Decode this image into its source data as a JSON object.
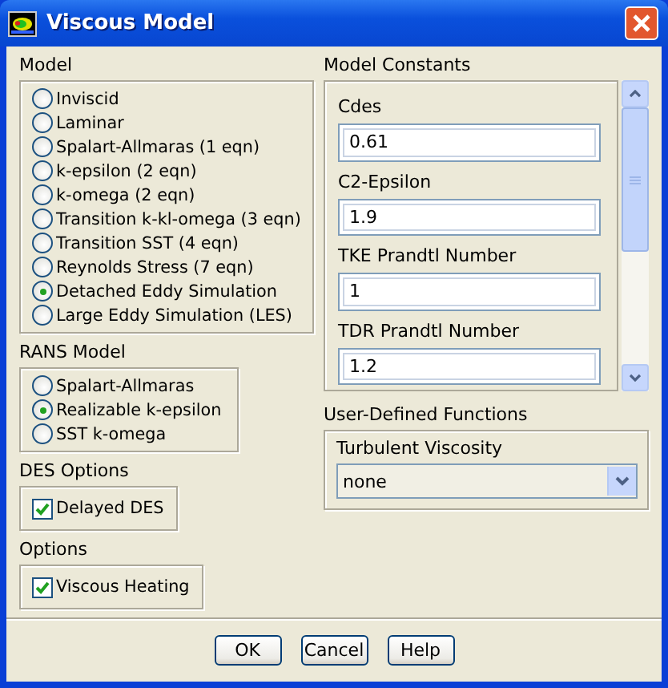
{
  "window": {
    "title": "Viscous Model"
  },
  "model": {
    "label": "Model",
    "options": [
      {
        "label": "Inviscid",
        "selected": false
      },
      {
        "label": "Laminar",
        "selected": false
      },
      {
        "label": "Spalart-Allmaras (1 eqn)",
        "selected": false
      },
      {
        "label": "k-epsilon (2 eqn)",
        "selected": false
      },
      {
        "label": "k-omega (2 eqn)",
        "selected": false
      },
      {
        "label": "Transition k-kl-omega (3 eqn)",
        "selected": false
      },
      {
        "label": "Transition SST (4 eqn)",
        "selected": false
      },
      {
        "label": "Reynolds Stress (7 eqn)",
        "selected": false
      },
      {
        "label": "Detached Eddy Simulation",
        "selected": true
      },
      {
        "label": "Large Eddy Simulation (LES)",
        "selected": false
      }
    ]
  },
  "rans_model": {
    "label": "RANS Model",
    "options": [
      {
        "label": "Spalart-Allmaras",
        "selected": false
      },
      {
        "label": "Realizable k-epsilon",
        "selected": true
      },
      {
        "label": "SST k-omega",
        "selected": false
      }
    ]
  },
  "des_options": {
    "label": "DES Options",
    "items": [
      {
        "label": "Delayed DES",
        "checked": true
      }
    ]
  },
  "options": {
    "label": "Options",
    "items": [
      {
        "label": "Viscous Heating",
        "checked": true
      }
    ]
  },
  "model_constants": {
    "label": "Model Constants",
    "fields": [
      {
        "label": "Cdes",
        "value": "0.61"
      },
      {
        "label": "C2-Epsilon",
        "value": "1.9"
      },
      {
        "label": "TKE Prandtl Number",
        "value": "1"
      },
      {
        "label": "TDR Prandtl Number",
        "value": "1.2"
      }
    ]
  },
  "user_defined_functions": {
    "label": "User-Defined Functions",
    "turbulent_viscosity": {
      "label": "Turbulent Viscosity",
      "value": "none"
    }
  },
  "buttons": [
    "OK",
    "Cancel",
    "Help"
  ]
}
